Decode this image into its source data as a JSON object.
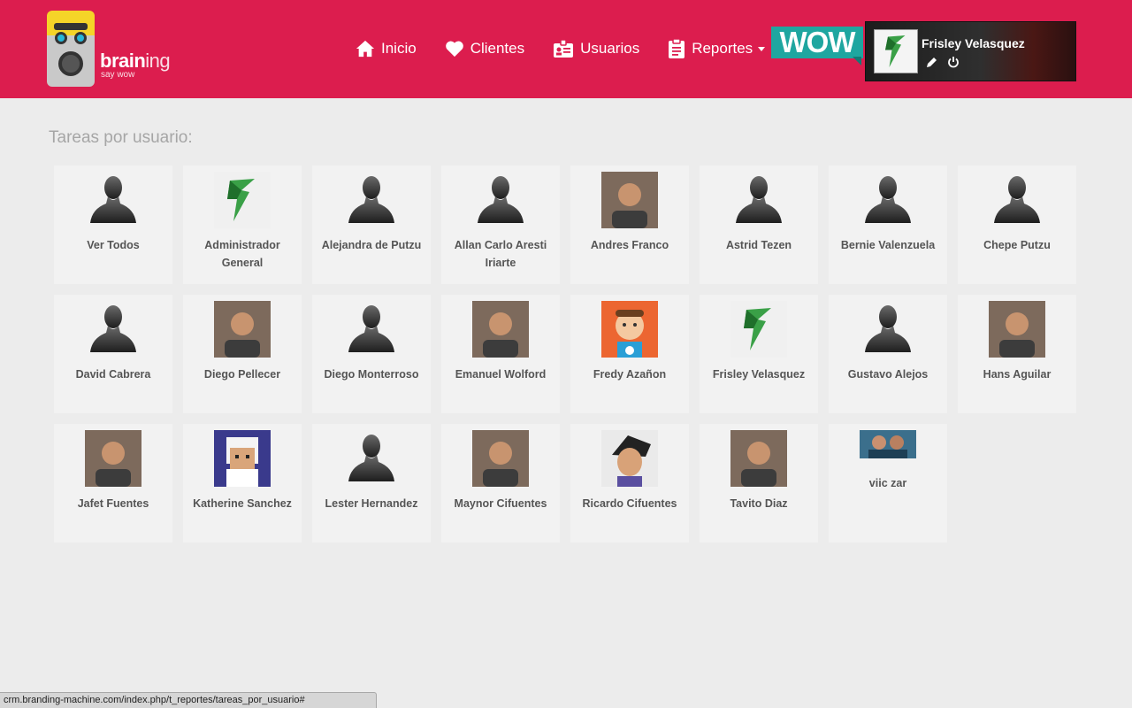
{
  "brand": {
    "name_bold": "brain",
    "name_thin": "ing",
    "tagline": "say wow",
    "accent": "#dc1d4e"
  },
  "nav": {
    "items": [
      {
        "label": "Inicio",
        "icon": "home-icon"
      },
      {
        "label": "Clientes",
        "icon": "heart-icon"
      },
      {
        "label": "Usuarios",
        "icon": "id-badge-icon"
      },
      {
        "label": "Reportes",
        "icon": "clipboard-icon",
        "dropdown": true
      }
    ]
  },
  "wow_badge": "WOW",
  "user": {
    "name": "Frisley Velasquez",
    "edit_icon": "pencil-icon",
    "logout_icon": "power-icon"
  },
  "page": {
    "title": "Tareas por usuario:"
  },
  "users": [
    {
      "name": "Ver Todos",
      "avatar": "silhouette"
    },
    {
      "name": "Administrador General",
      "avatar": "logo"
    },
    {
      "name": "Alejandra de Putzu",
      "avatar": "silhouette"
    },
    {
      "name": "Allan Carlo Aresti Iriarte",
      "avatar": "silhouette"
    },
    {
      "name": "Andres Franco",
      "avatar": "photo"
    },
    {
      "name": "Astrid Tezen",
      "avatar": "silhouette"
    },
    {
      "name": "Bernie Valenzuela",
      "avatar": "silhouette"
    },
    {
      "name": "Chepe Putzu",
      "avatar": "silhouette"
    },
    {
      "name": "David Cabrera",
      "avatar": "silhouette"
    },
    {
      "name": "Diego Pellecer",
      "avatar": "photo"
    },
    {
      "name": "Diego Monterroso",
      "avatar": "silhouette"
    },
    {
      "name": "Emanuel Wolford",
      "avatar": "photo"
    },
    {
      "name": "Fredy Azañon",
      "avatar": "cartoon"
    },
    {
      "name": "Frisley Velasquez",
      "avatar": "logo"
    },
    {
      "name": "Gustavo Alejos",
      "avatar": "silhouette"
    },
    {
      "name": "Hans Aguilar",
      "avatar": "photo"
    },
    {
      "name": "Jafet Fuentes",
      "avatar": "photo"
    },
    {
      "name": "Katherine Sanchez",
      "avatar": "pixel"
    },
    {
      "name": "Lester Hernandez",
      "avatar": "silhouette"
    },
    {
      "name": "Maynor Cifuentes",
      "avatar": "photo"
    },
    {
      "name": "Ricardo Cifuentes",
      "avatar": "cartoon2"
    },
    {
      "name": "Tavito Diaz",
      "avatar": "photo"
    },
    {
      "name": "viic zar",
      "avatar": "photo-small"
    }
  ],
  "status_bar": "crm.branding-machine.com/index.php/t_reportes/tareas_por_usuario#"
}
